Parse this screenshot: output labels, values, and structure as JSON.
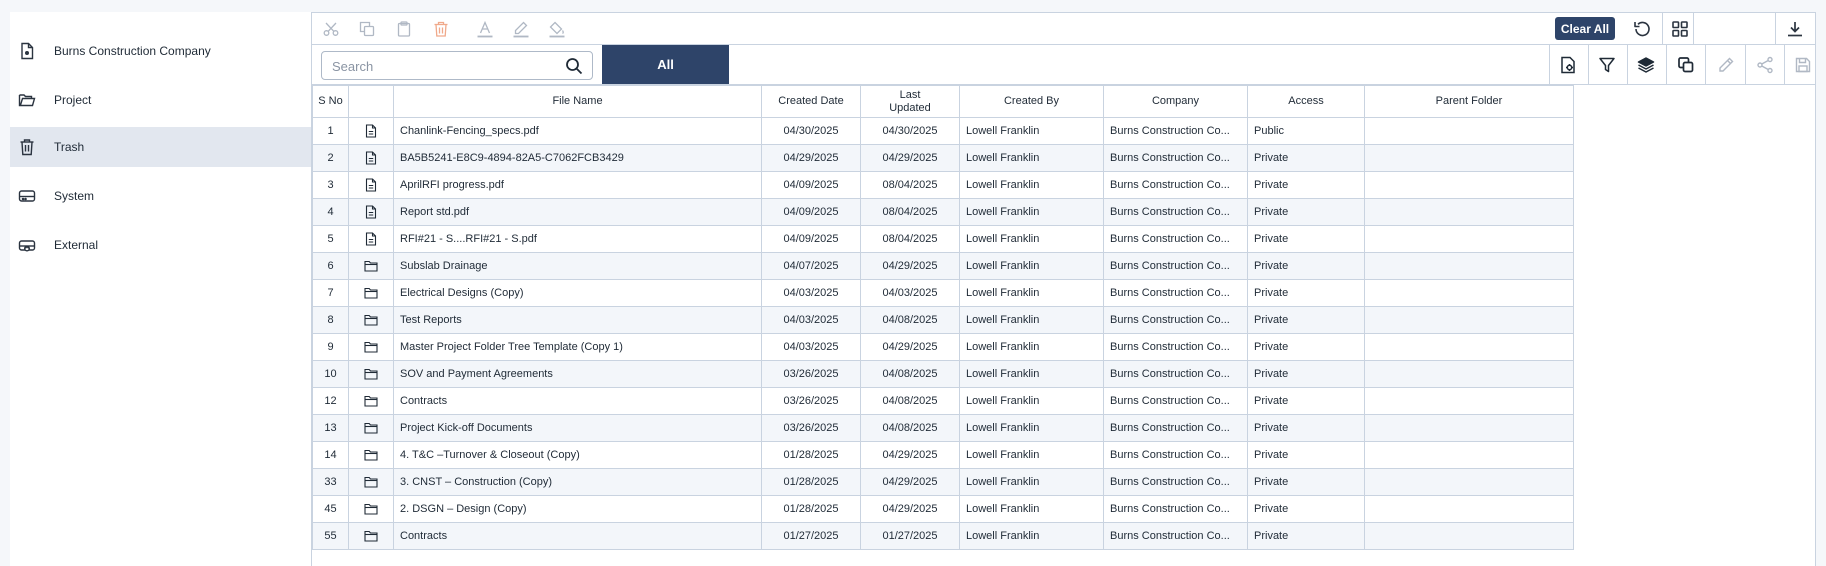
{
  "sidebar": {
    "items": [
      {
        "label": "Burns Construction Company",
        "icon": "company-doc-icon",
        "active": false
      },
      {
        "label": "Project",
        "icon": "folder-open-icon",
        "active": false
      },
      {
        "label": "Trash",
        "icon": "trash-icon",
        "active": true
      },
      {
        "label": "System",
        "icon": "hard-drive-icon",
        "active": false
      },
      {
        "label": "External",
        "icon": "cloud-drive-icon",
        "active": false
      }
    ]
  },
  "toolbar": {
    "clear_all_label": "Clear All",
    "icons_left": [
      "cut-icon",
      "copy-icon",
      "paste-icon",
      "delete-icon",
      "text-color-icon",
      "highlight-icon",
      "fill-color-icon"
    ],
    "icons_right": [
      "refresh-icon",
      "grid-view-icon",
      "download-icon"
    ],
    "icons_row2": [
      "file-settings-icon",
      "filter-icon",
      "layers-icon",
      "duplicate-icon",
      "edit-icon",
      "share-icon",
      "save-icon"
    ]
  },
  "search": {
    "placeholder": "Search",
    "value": ""
  },
  "tabs": {
    "all_label": "All"
  },
  "table": {
    "headers": {
      "sno": "S No",
      "icon": "",
      "file_name": "File Name",
      "created_date": "Created Date",
      "last_updated": "Last Updated",
      "created_by": "Created By",
      "company": "Company",
      "access": "Access",
      "parent_folder": "Parent Folder"
    },
    "rows": [
      {
        "sno": "1",
        "type": "file",
        "expand": false,
        "name": "Chanlink-Fencing_specs.pdf",
        "created": "04/30/2025",
        "updated": "04/30/2025",
        "by": "Lowell Franklin",
        "company": "Burns Construction Co...",
        "access": "Public",
        "parent": ""
      },
      {
        "sno": "2",
        "type": "file",
        "expand": false,
        "name": "BA5B5241-E8C9-4894-82A5-C7062FCB3429",
        "created": "04/29/2025",
        "updated": "04/29/2025",
        "by": "Lowell Franklin",
        "company": "Burns Construction Co...",
        "access": "Private",
        "parent": ""
      },
      {
        "sno": "3",
        "type": "file",
        "expand": false,
        "name": "AprilRFI progress.pdf",
        "created": "04/09/2025",
        "updated": "08/04/2025",
        "by": "Lowell Franklin",
        "company": "Burns Construction Co...",
        "access": "Private",
        "parent": ""
      },
      {
        "sno": "4",
        "type": "file",
        "expand": false,
        "name": "Report std.pdf",
        "created": "04/09/2025",
        "updated": "08/04/2025",
        "by": "Lowell Franklin",
        "company": "Burns Construction Co...",
        "access": "Private",
        "parent": ""
      },
      {
        "sno": "5",
        "type": "file",
        "expand": false,
        "name": "RFI#21 - S....RFI#21 - S.pdf",
        "created": "04/09/2025",
        "updated": "08/04/2025",
        "by": "Lowell Franklin",
        "company": "Burns Construction Co...",
        "access": "Private",
        "parent": ""
      },
      {
        "sno": "6",
        "type": "folder",
        "expand": false,
        "name": "Subslab Drainage",
        "created": "04/07/2025",
        "updated": "04/29/2025",
        "by": "Lowell Franklin",
        "company": "Burns Construction Co...",
        "access": "Private",
        "parent": ""
      },
      {
        "sno": "7",
        "type": "folder",
        "expand": false,
        "name": "Electrical Designs (Copy)",
        "created": "04/03/2025",
        "updated": "04/03/2025",
        "by": "Lowell Franklin",
        "company": "Burns Construction Co...",
        "access": "Private",
        "parent": ""
      },
      {
        "sno": "8",
        "type": "folder",
        "expand": false,
        "name": "Test Reports",
        "created": "04/03/2025",
        "updated": "04/08/2025",
        "by": "Lowell Franklin",
        "company": "Burns Construction Co...",
        "access": "Private",
        "parent": ""
      },
      {
        "sno": "9",
        "type": "folder",
        "expand": false,
        "name": "Master Project Folder Tree Template (Copy 1)",
        "created": "04/03/2025",
        "updated": "04/29/2025",
        "by": "Lowell Franklin",
        "company": "Burns Construction Co...",
        "access": "Private",
        "parent": ""
      },
      {
        "sno": "10",
        "type": "folder",
        "expand": true,
        "name": "SOV and Payment Agreements",
        "created": "03/26/2025",
        "updated": "04/08/2025",
        "by": "Lowell Franklin",
        "company": "Burns Construction Co...",
        "access": "Private",
        "parent": ""
      },
      {
        "sno": "12",
        "type": "folder",
        "expand": false,
        "name": "Contracts",
        "created": "03/26/2025",
        "updated": "04/08/2025",
        "by": "Lowell Franklin",
        "company": "Burns Construction Co...",
        "access": "Private",
        "parent": ""
      },
      {
        "sno": "13",
        "type": "folder",
        "expand": false,
        "name": "Project Kick-off Documents",
        "created": "03/26/2025",
        "updated": "04/08/2025",
        "by": "Lowell Franklin",
        "company": "Burns Construction Co...",
        "access": "Private",
        "parent": ""
      },
      {
        "sno": "14",
        "type": "folder",
        "expand": true,
        "name": "4. T&C –Turnover & Closeout (Copy)",
        "created": "01/28/2025",
        "updated": "04/29/2025",
        "by": "Lowell Franklin",
        "company": "Burns Construction Co...",
        "access": "Private",
        "parent": ""
      },
      {
        "sno": "33",
        "type": "folder",
        "expand": true,
        "name": "3. CNST – Construction (Copy)",
        "created": "01/28/2025",
        "updated": "04/29/2025",
        "by": "Lowell Franklin",
        "company": "Burns Construction Co...",
        "access": "Private",
        "parent": ""
      },
      {
        "sno": "45",
        "type": "folder",
        "expand": true,
        "name": "2. DSGN – Design (Copy)",
        "created": "01/28/2025",
        "updated": "04/29/2025",
        "by": "Lowell Franklin",
        "company": "Burns Construction Co...",
        "access": "Private",
        "parent": ""
      },
      {
        "sno": "55",
        "type": "folder",
        "expand": false,
        "name": "Contracts",
        "created": "01/27/2025",
        "updated": "01/27/2025",
        "by": "Lowell Franklin",
        "company": "Burns Construction Co...",
        "access": "Private",
        "parent": ""
      }
    ]
  },
  "colors": {
    "accent": "#2e4469",
    "border": "#c9d3e0",
    "active_bg": "#e2e7ef",
    "disabled_icon": "#b0b8c4",
    "delete_disabled": "#f0a98a"
  }
}
